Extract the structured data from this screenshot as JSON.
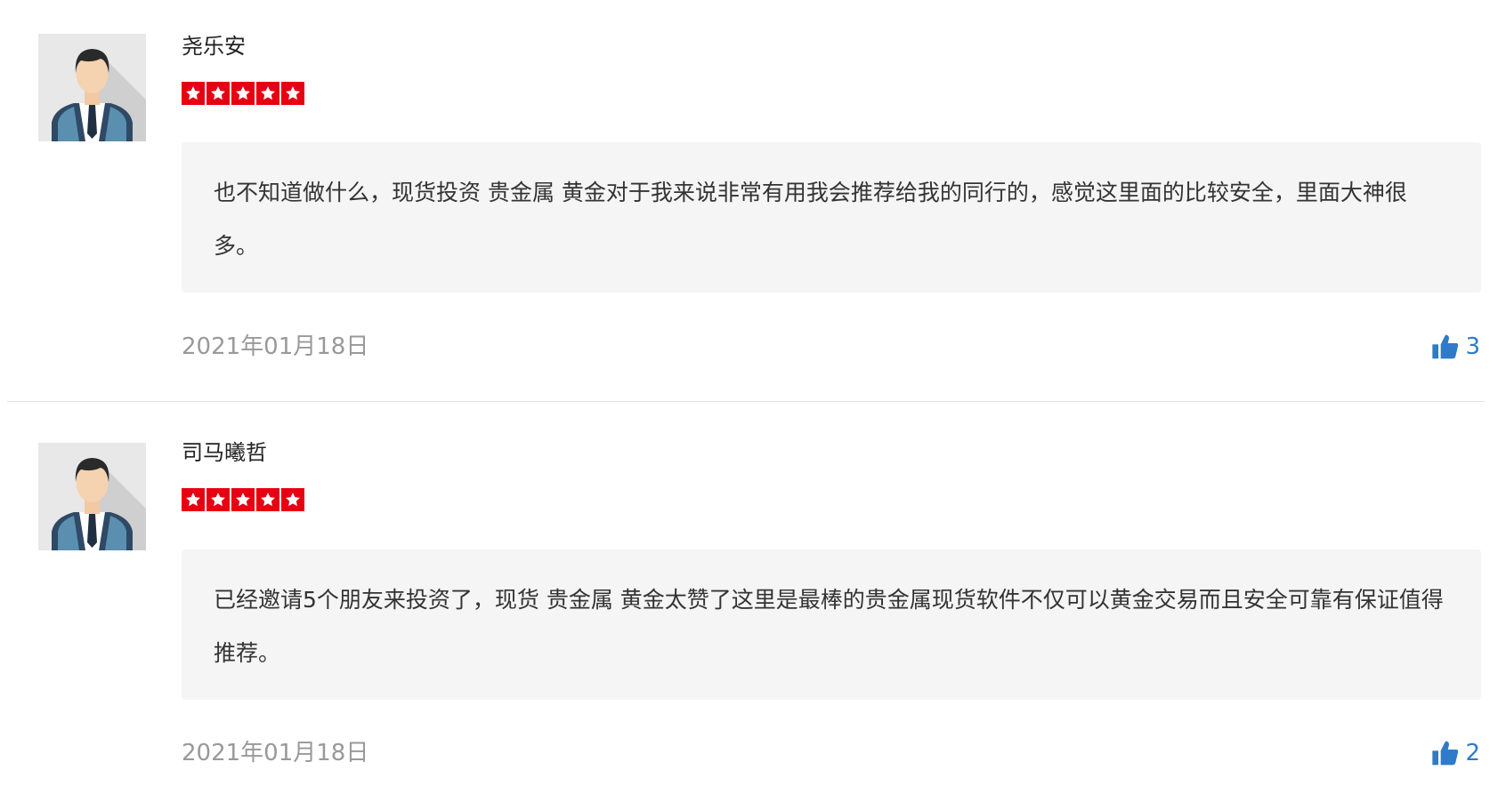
{
  "reviews": [
    {
      "username": "尧乐安",
      "rating": 5,
      "comment": "也不知道做什么，现货投资 贵金属 黄金对于我来说非常有用我会推荐给我的同行的，感觉这里面的比较安全，里面大神很多。",
      "date": "2021年01月18日",
      "likes": "3"
    },
    {
      "username": "司马曦哲",
      "rating": 5,
      "comment": "已经邀请5个朋友来投资了，现货 贵金属 黄金太赞了这里是最棒的贵金属现货软件不仅可以黄金交易而且安全可靠有保证值得推荐。",
      "date": "2021年01月18日",
      "likes": "2"
    }
  ],
  "icons": {
    "avatar": "user-avatar-icon",
    "star": "star-icon",
    "like": "thumbs-up-icon"
  },
  "colors": {
    "star_bg": "#e60012",
    "like": "#2f7ac9",
    "date": "#999999",
    "comment_bg": "#f5f5f5"
  }
}
